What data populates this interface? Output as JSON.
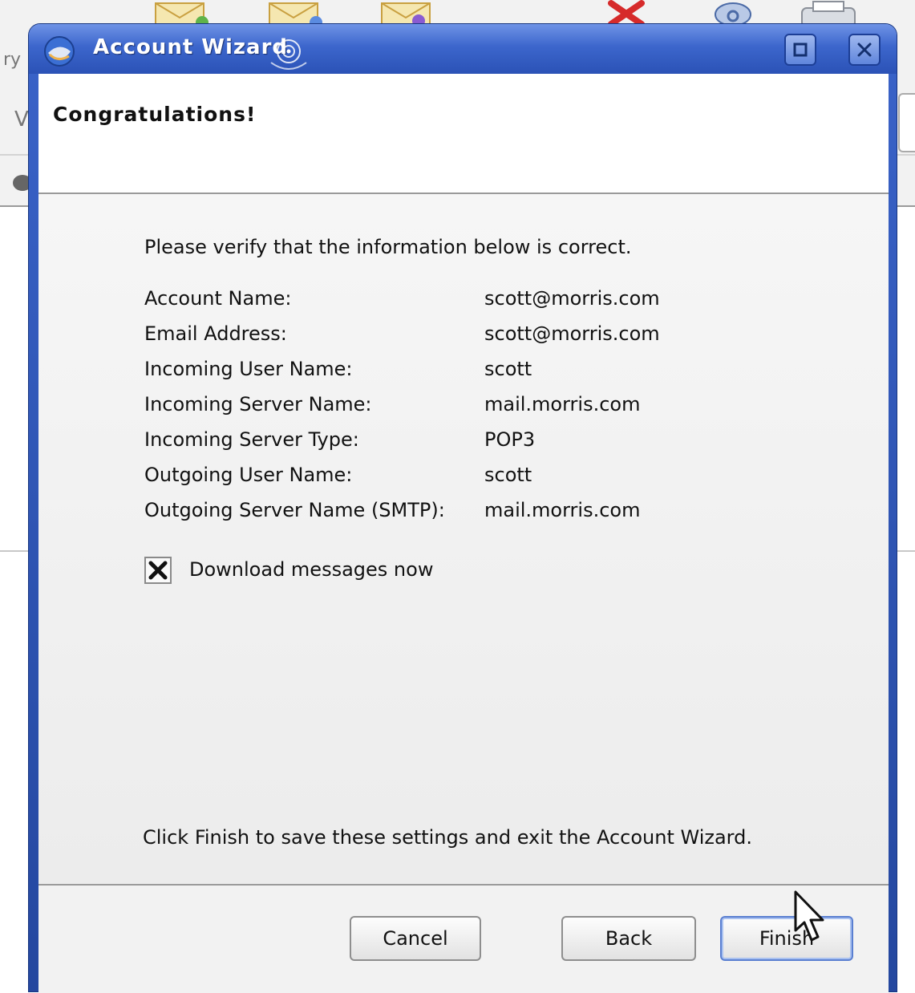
{
  "window": {
    "title": "Account Wizard",
    "maximize_symbol": "□",
    "close_symbol": "✕"
  },
  "background": {
    "left_text_1": "ry",
    "left_text_2": "V"
  },
  "page": {
    "title": "Congratulations!",
    "intro": "Please verify that the information below is correct.",
    "rows": [
      {
        "label": "Account Name:",
        "value": "scott@morris.com"
      },
      {
        "label": "Email Address:",
        "value": "scott@morris.com"
      },
      {
        "label": "Incoming User Name:",
        "value": "scott"
      },
      {
        "label": "Incoming Server Name:",
        "value": "mail.morris.com"
      },
      {
        "label": "Incoming Server Type:",
        "value": "POP3"
      },
      {
        "label": "Outgoing User Name:",
        "value": "scott"
      },
      {
        "label": "Outgoing Server Name (SMTP):",
        "value": "mail.morris.com"
      }
    ],
    "download_checkbox": {
      "label": "Download messages now",
      "checked": true
    },
    "footer_note": "Click Finish to save these settings and exit the Account Wizard."
  },
  "buttons": {
    "cancel": "Cancel",
    "back": "Back",
    "finish": "Finish"
  },
  "icons": {
    "app": "thunderbird-icon",
    "maximize": "maximize-icon",
    "close": "close-icon",
    "checkbox_mark": "x-check-mark"
  },
  "colors": {
    "titlebar": "#3c66cc",
    "frame": "#24479f",
    "content_bg": "#ececec"
  }
}
